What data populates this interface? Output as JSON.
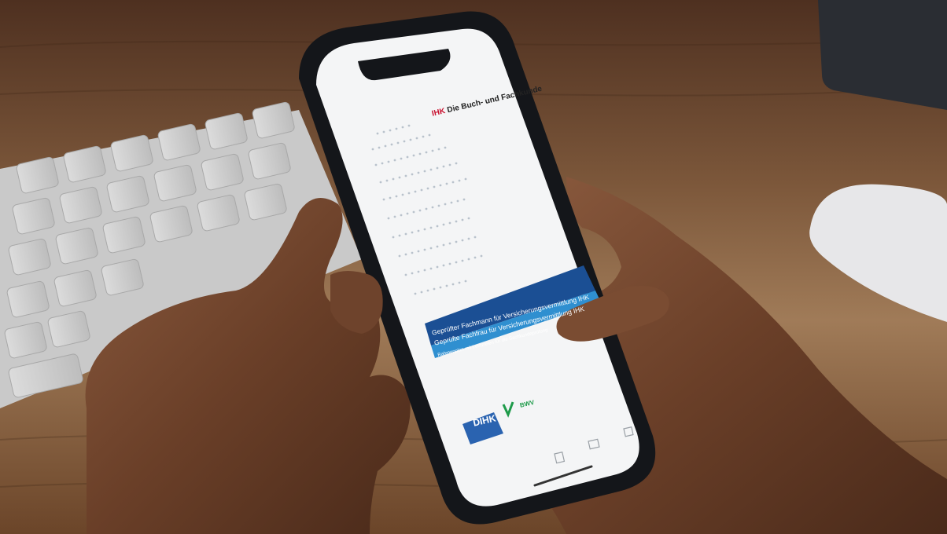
{
  "photo": {
    "subject": "hands-holding-smartphone",
    "objects": [
      "keyboard",
      "mouse",
      "phone",
      "desk"
    ]
  },
  "document": {
    "brand": {
      "mark": "IHK",
      "name": "Die Buch- und Fachkunde"
    },
    "banner_lines": [
      "Geprüfter Fachmann für Versicherungsvermittlung IHK",
      "Geprüfte Fachfrau für Versicherungsvermittlung IHK",
      "Rahmenplan mit Lernzielen für die Sachkundeprüfung"
    ],
    "logos": {
      "dihk": "DIHK",
      "bwv": "BWV"
    }
  },
  "colors": {
    "banner_dark": "#1b4f94",
    "banner_light": "#2f8fd0",
    "map_dots": "#b9c2cc",
    "brand_red": "#c8102e",
    "bwv_green": "#1e9b4a"
  }
}
